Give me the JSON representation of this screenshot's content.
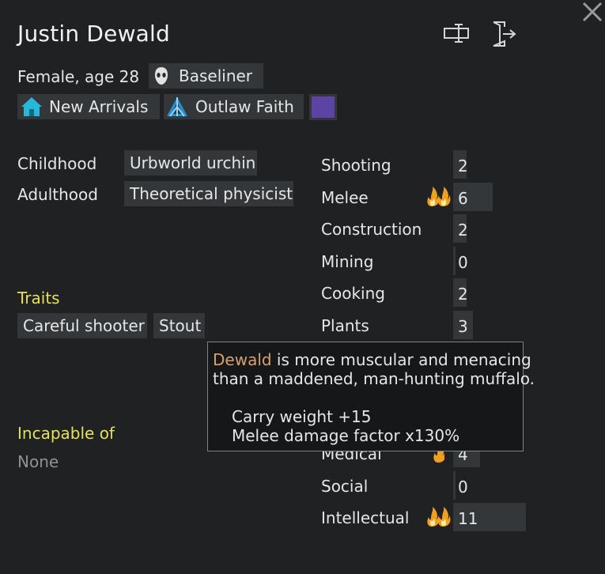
{
  "pawn": {
    "name": "Justin Dewald",
    "gender_age": "Female, age 28",
    "xenotype": "Baseliner",
    "faction": "New Arrivals",
    "ideology": "Outlaw Faith",
    "favorite_color": "#5b44a6"
  },
  "backstory": {
    "childhood_label": "Childhood",
    "childhood_value": "Urbworld urchin",
    "adulthood_label": "Adulthood",
    "adulthood_value": "Theoretical physicist"
  },
  "traits": {
    "label": "Traits",
    "items": [
      "Careful shooter",
      "Stout"
    ]
  },
  "incapable": {
    "label": "Incapable of",
    "value": "None"
  },
  "skills": [
    {
      "name": "Shooting",
      "value": "2",
      "passion": "none",
      "level": 2
    },
    {
      "name": "Melee",
      "value": "6",
      "passion": "major",
      "level": 6
    },
    {
      "name": "Construction",
      "value": "2",
      "passion": "none",
      "level": 2
    },
    {
      "name": "Mining",
      "value": "0",
      "passion": "none",
      "level": 0
    },
    {
      "name": "Cooking",
      "value": "2",
      "passion": "none",
      "level": 2
    },
    {
      "name": "Plants",
      "value": "3",
      "passion": "none",
      "level": 3
    },
    {
      "name": "Medical",
      "value": "4",
      "passion": "minor",
      "level": 4
    },
    {
      "name": "Social",
      "value": "0",
      "passion": "none",
      "level": 0
    },
    {
      "name": "Intellectual",
      "value": "11",
      "passion": "major",
      "level": 11
    }
  ],
  "tooltip": {
    "subject": "Dewald",
    "line1_rest": " is more muscular and menacing",
    "line2": "than a maddened, man-hunting muffalo.",
    "effect1": "Carry weight +15",
    "effect2": "Melee damage factor x130%"
  }
}
